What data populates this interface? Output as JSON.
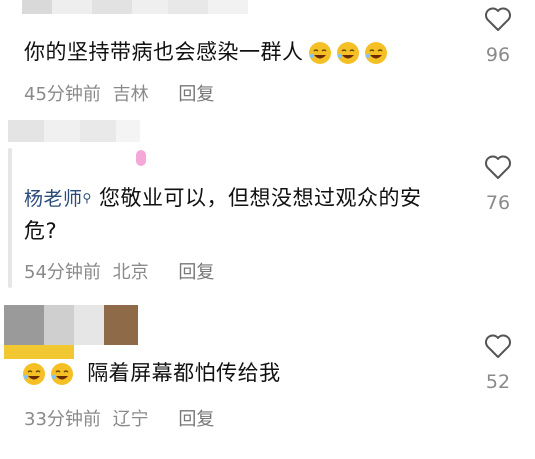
{
  "comments": [
    {
      "author": "",
      "text": "你的坚持带病也会感染一群人",
      "emoji_count": 3,
      "time": "45分钟前",
      "location": "吉林",
      "reply_label": "回复",
      "likes": "96"
    },
    {
      "author": "杨老师",
      "text_line1": "您敬业可以，但想没想过观众的安",
      "text_line2": "危?",
      "time": "54分钟前",
      "location": "北京",
      "reply_label": "回复",
      "likes": "76"
    },
    {
      "author": "",
      "text": "隔着屏幕都怕传给我",
      "emoji_count": 2,
      "time": "33分钟前",
      "location": "辽宁",
      "reply_label": "回复",
      "likes": "52"
    }
  ],
  "icons": {
    "like": "heart-outline-icon",
    "emoji": "sweat-laugh-emoji-icon"
  },
  "colors": {
    "text": "#111111",
    "meta": "#8a8a8a",
    "name": "#2b4b7a",
    "emoji_face": "#f5c026"
  }
}
